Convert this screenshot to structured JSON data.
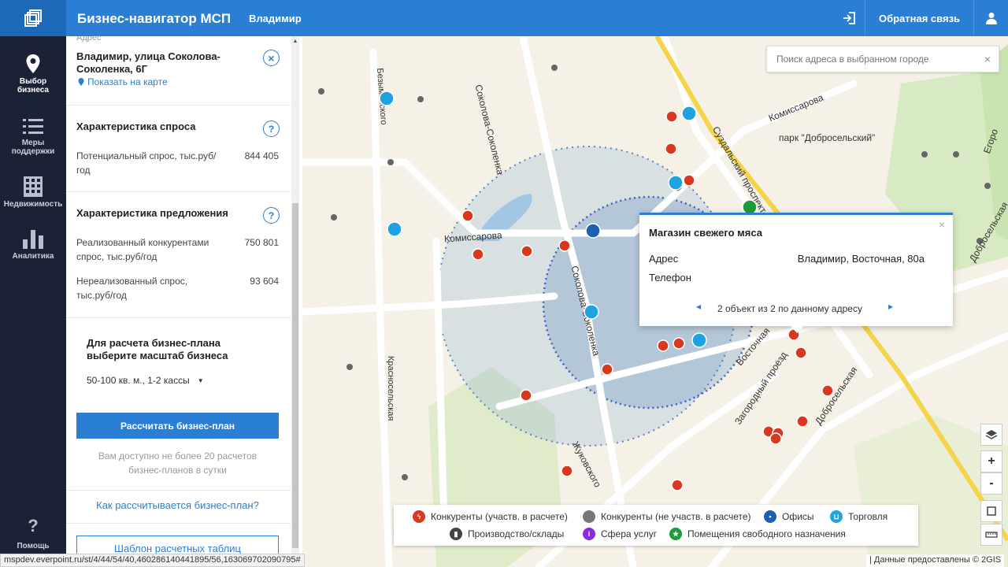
{
  "header": {
    "title": "Бизнес-навигатор МСП",
    "city": "Владимир",
    "feedback": "Обратная связь"
  },
  "nav": [
    {
      "label_1": "Выбор",
      "label_2": "бизнеса",
      "icon": "location-pin-icon"
    },
    {
      "label_1": "Меры",
      "label_2": "поддержки",
      "icon": "list-icon"
    },
    {
      "label_1": "Недвижимость",
      "label_2": "",
      "icon": "building-icon"
    },
    {
      "label_1": "Аналитика",
      "label_2": "",
      "icon": "bar-chart-icon"
    },
    {
      "label_1": "Помощь",
      "label_2": "",
      "icon": "question-icon"
    }
  ],
  "panel": {
    "address_label": "Адрес",
    "address_line1": "Владимир, улица Соколова-",
    "address_line2": "Соколенка, 6Г",
    "show_on_map": "Показать на карте",
    "demand": {
      "title": "Характеристика спроса",
      "label_1": "Потенциальный спрос, тыс.руб/",
      "label_2": "год",
      "value": "844 405"
    },
    "supply": {
      "title": "Характеристика предложения",
      "row1_label_1": "Реализованный конкурентами",
      "row1_label_2": "спрос, тыс.руб/год",
      "row1_value": "750 801",
      "row2_label_1": "Нереализованный спрос,",
      "row2_label_2": "тыс.руб/год",
      "row2_value": "93 604"
    },
    "plan": {
      "title_1": "Для расчета бизнес-плана",
      "title_2": "выберите масштаб бизнеса",
      "scale": "50-100 кв. м., 1-2 кассы",
      "button": "Рассчитать бизнес-план",
      "limit_1": "Вам доступно не более 20 расчетов",
      "limit_2": "бизнес-планов в сутки",
      "how_link": "Как рассчитывается бизнес-план?",
      "template_button": "Шаблон расчетных таблиц"
    }
  },
  "search": {
    "placeholder": "Поиск адреса в выбранном городе"
  },
  "popup": {
    "title": "Магазин свежего мяса",
    "addr_label": "Адрес",
    "addr_value": "Владимир, Восточная, 80а",
    "phone_label": "Телефон",
    "pager": "2 объект из 2 по данному адресу"
  },
  "map_labels": {
    "komissarova_1": "Комиссарова",
    "komissarova_2": "Комиссарова",
    "sokolova_1": "Соколова-Соколенка",
    "sokolova_2": "Соколова-Соколенка",
    "bezymenskogo": "Безыменского",
    "krasnoselskaya": "Красносельская",
    "suzdalsky": "Суздальский проспект",
    "park": "парк \"Добросельский\"",
    "vostochnaya": "Восточная",
    "zagorodny": "Загородный проезд",
    "dobroselskaya_1": "Добросельская",
    "dobroselskaya_2": "Добросельская",
    "zhukovskogo": "Жуковского",
    "egorova": "Егоро"
  },
  "legend": [
    {
      "label": "Конкуренты (участв. в расчете)",
      "color": "#d9381e"
    },
    {
      "label": "Конкуренты (не участв. в расчете)",
      "color": "#777777"
    },
    {
      "label": "Офисы",
      "color": "#1d5fb0"
    },
    {
      "label": "Торговля",
      "color": "#1fa3e0"
    },
    {
      "label": "Производство/склады",
      "color": "#444444"
    },
    {
      "label": "Сфера услуг",
      "color": "#8a2be2"
    },
    {
      "label": "Помещения свободного назначения",
      "color": "#1d9a3a"
    }
  ],
  "status_url": "mspdev.everpoint.ru/st/4/44/54/40,460286140441895/56,163069702090795#",
  "attribution": "| Данные предоставлены © 2GIS"
}
